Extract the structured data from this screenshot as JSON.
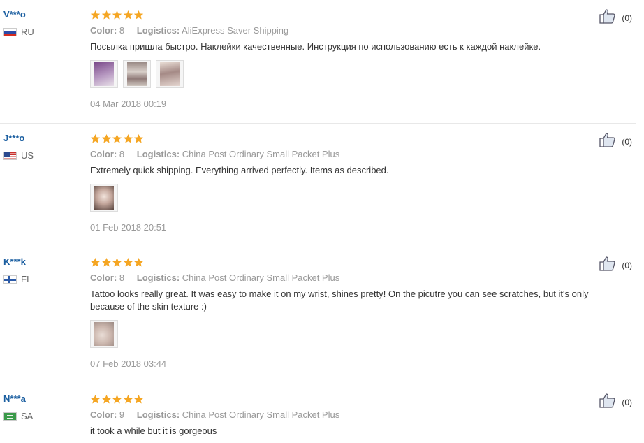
{
  "labels": {
    "color": "Color:",
    "logistics": "Logistics:"
  },
  "colors": {
    "star": "#f5a623",
    "username": "#1a5ea0",
    "muted": "#999999"
  },
  "reviews": [
    {
      "user": "V***o",
      "country": "RU",
      "flag": "russia",
      "rating": 5,
      "color": "8",
      "logistics": "AliExpress Saver Shipping",
      "text": "Посылка пришла быстро. Наклейки качественные. Инструкция по использованию есть к каждой наклейке.",
      "photos": 3,
      "date": "04 Mar 2018 00:19",
      "likes": "(0)"
    },
    {
      "user": "J***o",
      "country": "US",
      "flag": "usa",
      "rating": 5,
      "color": "8",
      "logistics": "China Post Ordinary Small Packet Plus",
      "text": "Extremely quick shipping. Everything arrived perfectly. Items as described.",
      "photos": 1,
      "date": "01 Feb 2018 20:51",
      "likes": "(0)"
    },
    {
      "user": "K***k",
      "country": "FI",
      "flag": "finland",
      "rating": 5,
      "color": "8",
      "logistics": "China Post Ordinary Small Packet Plus",
      "text": "Tattoo looks really great. It was easy to make it on my wrist, shines pretty! On the picutre you can see scratches, but it's only because of the skin texture :)",
      "photos": 1,
      "date": "07 Feb 2018 03:44",
      "likes": "(0)"
    },
    {
      "user": "N***a",
      "country": "SA",
      "flag": "saudi",
      "rating": 5,
      "color": "9",
      "logistics": "China Post Ordinary Small Packet Plus",
      "text": "it took a while but it is gorgeous",
      "photos": 0,
      "date": "",
      "likes": "(0)"
    }
  ]
}
